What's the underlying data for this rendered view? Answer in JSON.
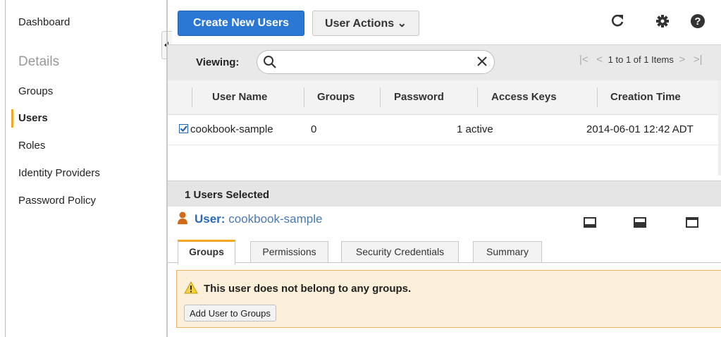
{
  "sidebar": {
    "dashboard": "Dashboard",
    "section_heading": "Details",
    "items": [
      "Groups",
      "Users",
      "Roles",
      "Identity Providers",
      "Password Policy"
    ],
    "active_index": 1
  },
  "toolbar": {
    "create_button": "Create New Users",
    "actions_button": "User Actions ⌄",
    "icons": [
      "refresh-icon",
      "gear-icon",
      "help-icon"
    ]
  },
  "viewing": {
    "label": "Viewing:",
    "search_value": "",
    "pager_text": "1 to 1 of 1 Items"
  },
  "table": {
    "columns": [
      "User Name",
      "Groups",
      "Password",
      "Access Keys",
      "Creation Time"
    ],
    "rows": [
      {
        "user_name": "cookbook-sample",
        "groups": "0",
        "password": "",
        "access_keys": "1 active",
        "creation_time": "2014-06-01 12:42 ADT",
        "checked": true
      }
    ]
  },
  "details": {
    "selected_text": "1 Users Selected",
    "user_label": "User:",
    "user_name": "cookbook-sample",
    "tabs": [
      "Groups",
      "Permissions",
      "Security Credentials",
      "Summary"
    ],
    "active_tab": "Groups",
    "alert_message": "This user does not belong to any groups.",
    "add_button": "Add User to Groups"
  },
  "colors": {
    "primary": "#2a77d4",
    "accent": "#f5a623",
    "alert_bg": "#fcf0db",
    "link": "#2b69b3"
  }
}
